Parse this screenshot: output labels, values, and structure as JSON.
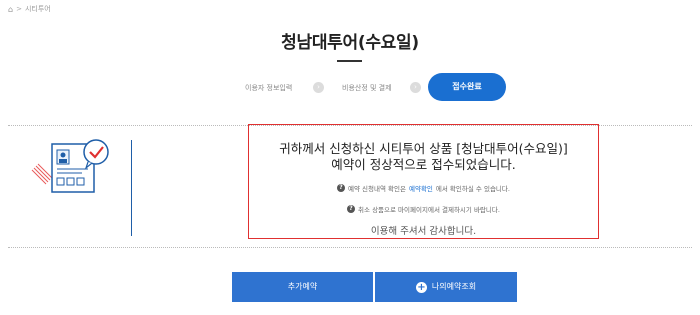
{
  "breadcrumb": {
    "home_icon": "home-icon",
    "separator": ">",
    "current": "시티투어"
  },
  "page": {
    "title": "청남대투어(수요일)"
  },
  "steps": {
    "step1": "이용자 정보입력",
    "step2": "비용산정 및 결제",
    "step3": "접수완료",
    "arrow_glyph": "›"
  },
  "message": {
    "line1": "귀하께서 신청하신 시티투어 상품 [청남대투어(수요일)]",
    "line2": "예약이 정상적으로 접수되었습니다.",
    "info1_pre": "예약 신청내역 확인은",
    "info1_link": "예약확인",
    "info1_post": "에서 확인하실 수 있습니다.",
    "info2": "취소 상품으로 마이페이지에서 결제하시기 바랍니다.",
    "thanks": "이용해 주셔서 감사합니다."
  },
  "buttons": {
    "add_reservation": "추가예약",
    "my_reservation": "나의예약조회"
  },
  "colors": {
    "accent": "#1a6fd1",
    "button": "#2f73d0",
    "highlight_border": "#e03030"
  }
}
